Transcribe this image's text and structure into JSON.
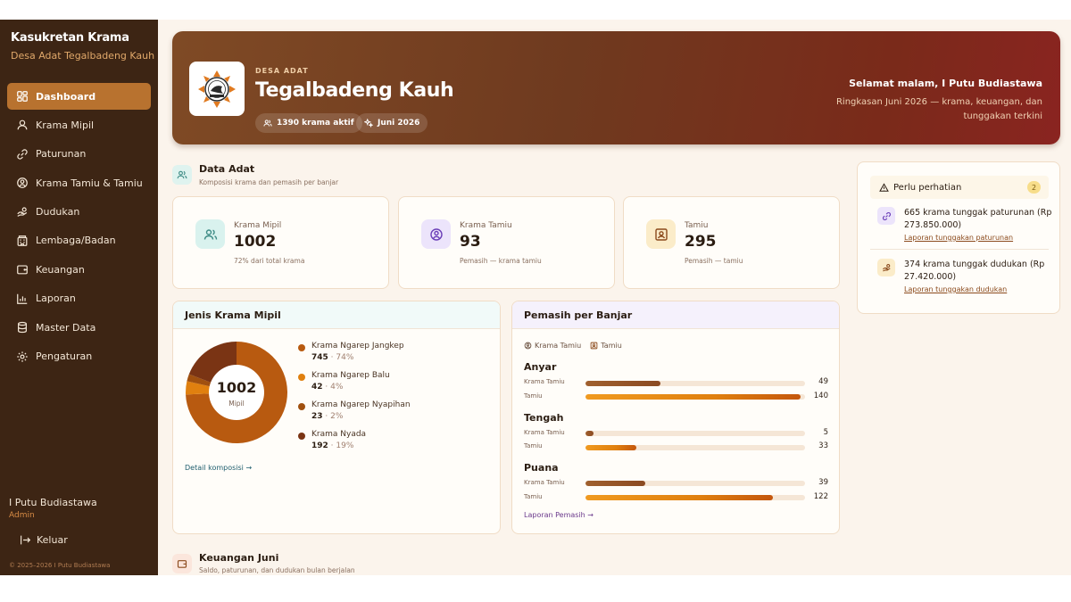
{
  "sidebar": {
    "title": "Kasukretan Krama",
    "subtitle": "Desa Adat Tegalbadeng Kauh",
    "items": [
      {
        "label": "Dashboard",
        "icon": "dashboard-icon"
      },
      {
        "label": "Krama Mipil",
        "icon": "user-icon"
      },
      {
        "label": "Paturunan",
        "icon": "link-icon"
      },
      {
        "label": "Krama Tamiu & Tamiu",
        "icon": "user-circle-icon"
      },
      {
        "label": "Dudukan",
        "icon": "hand-coins-icon"
      },
      {
        "label": "Lembaga/Badan",
        "icon": "building-icon"
      },
      {
        "label": "Keuangan",
        "icon": "wallet-icon"
      },
      {
        "label": "Laporan",
        "icon": "bar-chart-icon"
      },
      {
        "label": "Master Data",
        "icon": "database-icon"
      },
      {
        "label": "Pengaturan",
        "icon": "gear-icon"
      }
    ],
    "user_name": "I Putu Budiastawa",
    "user_role": "Admin",
    "logout_label": "Keluar",
    "copyright": "© 2025–2026 I Putu Budiastawa"
  },
  "hero": {
    "eyebrow": "DESA ADAT",
    "title": "Tegalbadeng Kauh",
    "pill_krama": "1390 krama aktif",
    "pill_month": "Juni 2026",
    "greeting": "Selamat malam, I Putu Budiastawa",
    "summary": "Ringkasan Juni 2026 — krama, keuangan, dan tunggakan terkini"
  },
  "data_adat": {
    "title": "Data Adat",
    "subtitle": "Komposisi krama dan pemasih per banjar"
  },
  "stats": [
    {
      "label": "Krama Mipil",
      "value": "1002",
      "note": "72% dari total krama"
    },
    {
      "label": "Krama Tamiu",
      "value": "93",
      "note": "Pemasih — krama tamiu"
    },
    {
      "label": "Tamiu",
      "value": "295",
      "note": "Pemasih — tamiu"
    }
  ],
  "jenis": {
    "title": "Jenis Krama Mipil",
    "center_value": "1002",
    "center_label": "Mipil",
    "link": "Detail komposisi →"
  },
  "pemasih": {
    "title": "Pemasih per Banjar",
    "legend_krama_tamiu": "Krama Tamiu",
    "legend_tamiu": "Tamiu",
    "label_krama_tamiu": "Krama Tamiu",
    "label_tamiu": "Tamiu",
    "link": "Laporan Pemasih →"
  },
  "alerts": {
    "title": "Perlu perhatian",
    "count": "2",
    "items": [
      {
        "text": "665 krama tunggak paturunan (Rp 273.850.000)",
        "link": "Laporan tunggakan paturunan"
      },
      {
        "text": "374 krama tunggak dudukan (Rp 27.420.000)",
        "link": "Laporan tunggakan dudukan"
      }
    ]
  },
  "keuangan": {
    "title": "Keuangan Juni",
    "subtitle": "Saldo, paturunan, dan dudukan bulan berjalan"
  },
  "colors": {
    "sidebar_bg": "#3d2514",
    "active": "#b8722f",
    "bar_krama_tamiu": "#8b4a22",
    "bar_tamiu": "#e0800f"
  },
  "chart_data": [
    {
      "type": "pie",
      "title": "Jenis Krama Mipil",
      "labels": [
        "Krama Ngarep Jangkep",
        "Krama Ngarep Balu",
        "Krama Ngarep Nyapihan",
        "Krama Nyada"
      ],
      "values": [
        745,
        42,
        23,
        192
      ],
      "percents": [
        "74%",
        "4%",
        "2%",
        "19%"
      ],
      "colors": [
        "#b85a10",
        "#e0800f",
        "#a0500f",
        "#7a3414"
      ]
    },
    {
      "type": "bar",
      "title": "Pemasih per Banjar",
      "categories": [
        "Anyar",
        "Tengah",
        "Puana"
      ],
      "series": [
        {
          "name": "Krama Tamiu",
          "values": [
            49,
            5,
            39
          ]
        },
        {
          "name": "Tamiu",
          "values": [
            140,
            33,
            122
          ]
        }
      ],
      "xlim": [
        0,
        143
      ]
    }
  ]
}
